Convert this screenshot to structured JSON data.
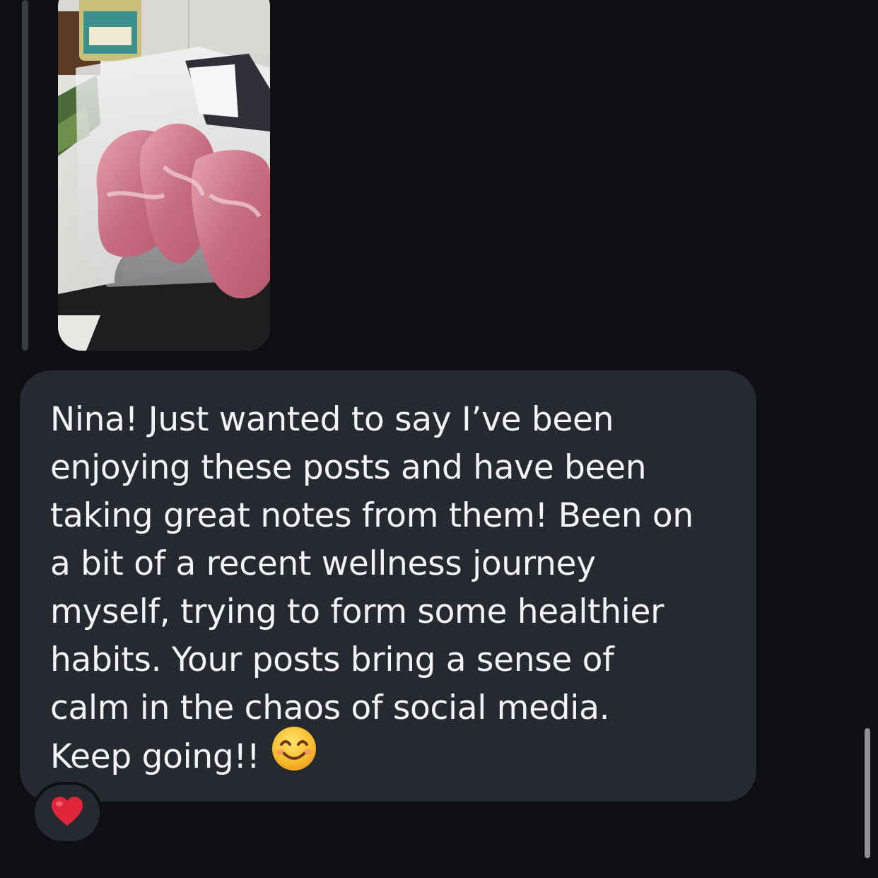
{
  "message": {
    "lines": [
      "Nina! Just wanted to say I’ve been",
      "enjoying these posts and have been",
      "taking great notes from them! Been on",
      "a bit of a recent wellness journey",
      "myself, trying to form some healthier",
      "habits. Your posts bring a sense of",
      "calm in the chaos of social media.",
      "Keep going!!"
    ],
    "emoji": "smiling-face-with-smiling-eyes"
  },
  "reaction": {
    "emoji": "red-heart"
  },
  "colors": {
    "background": "#0d0f12",
    "bubble": "#26292f",
    "text": "#f2f3f5",
    "heart": "#e0243a"
  }
}
